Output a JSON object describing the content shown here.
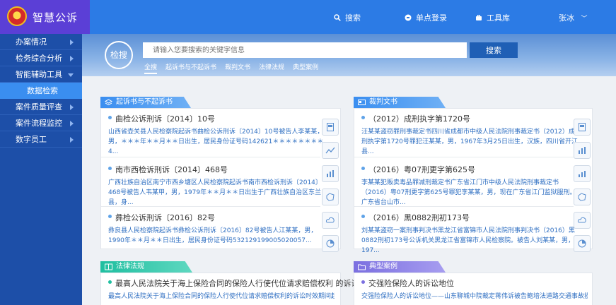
{
  "app": {
    "title": "智慧公诉"
  },
  "header": {
    "search_label": "搜索",
    "sso_label": "单点登录",
    "tools_label": "工具库",
    "user_name": "张冰"
  },
  "sidebar": {
    "items": [
      {
        "label": "办案情况"
      },
      {
        "label": "检务综合分析"
      },
      {
        "label": "智能辅助工具"
      },
      {
        "label": "数据检索"
      },
      {
        "label": "案件质量评查"
      },
      {
        "label": "案件流程监控"
      },
      {
        "label": "数字员工"
      }
    ]
  },
  "search": {
    "logo_text": "检搜",
    "placeholder": "请输入您要搜索的关键字信息",
    "button_label": "搜索",
    "tabs": [
      "全搜",
      "起诉书与不起诉书",
      "裁判文书",
      "法律法规",
      "典型案例"
    ]
  },
  "cards": {
    "indictment": {
      "title": "起诉书与不起诉书",
      "entries": [
        {
          "title": "曲检公诉刑诉〔2014〕10号",
          "desc": "山西省壶关县人民检察院起诉书曲检公诉刑诉〔2014〕10号被告人李某某，男，＊＊＊年＊＊月＊＊日出生，居民身份证号码142621＊＊＊＊＊＊＊＊4..."
        },
        {
          "title": "南市西检诉刑诉〔2014〕468号",
          "desc": "广西壮族自治区南宁市西乡塘区人民检察院起诉书南市西检诉刑诉〔2014〕468号被告人韦某甲，男，1979年＊＊月＊＊日出生于广西壮族自治区东兰县，身..."
        },
        {
          "title": "彝检公诉刑诉〔2016〕82号",
          "desc": "彝良县人民检察院起诉书彝检公诉刑诉〔2016〕82号被告人江某某，男，1990年＊＊月＊＊日出生，居民身份证号码532129199005020057..."
        }
      ]
    },
    "judgment": {
      "title": "裁判文书",
      "entries": [
        {
          "title": "（2012）成刑执字第1720号",
          "desc": "汪某某盗窃罪刑事裁定书四川省成都市中级人民法院刑事裁定书（2012）成刑执字第1720号罪犯汪某某，男，1967年3月25日出生，汉族，四川省开江县..."
        },
        {
          "title": "（2016）粤07刑更字第625号",
          "desc": "李某某犯贩卖毒品罪减刑裁定书广东省江门市中级人民法院刑事裁定书（2016）粤07刑更字第625号罪犯李某某，男，现在广东省江门监狱服刑。广东省台山市..."
        },
        {
          "title": "（2016）黑0882刑初173号",
          "desc": "刘某某盗窃一案刑事判决书黑龙江省富锦市人民法院刑事判决书（2016）黑0882刑初173号公诉机关黑龙江省富锦市人民检察院。被告人刘某某，男，197..."
        }
      ]
    },
    "laws": {
      "title": "法律法规",
      "entries": [
        {
          "title": "最高人民法院关于海上保险合同的保险人行使代位请求赔偿权利 的诉讼时...",
          "desc": "最高人民法院关于海上保险合同的保险人行使代位请求赔偿权利的诉讼时效期间起算"
        }
      ]
    },
    "cases": {
      "title": "典型案例",
      "entries": [
        {
          "title": "交强险保险人的诉讼地位",
          "desc": "交强险保险人的诉讼地位——山东聊城中院裁定蒋伟诉被告鲍培法道路交通事故损害"
        }
      ]
    }
  },
  "icon_names": [
    "document-icon",
    "trend-icon",
    "bar-chart-icon",
    "map-icon",
    "cloud-icon",
    "pie-icon"
  ],
  "colors": {
    "header_blue": "#2c7be5",
    "logo_purple": "#5b3fd6",
    "sidebar_blue": "#1d4fa8",
    "active_sub": "#3a8ef0",
    "tab_indictment": "#3a8ef0",
    "tab_laws": "#1fbfa0",
    "tab_cases": "#7b6fe0"
  }
}
